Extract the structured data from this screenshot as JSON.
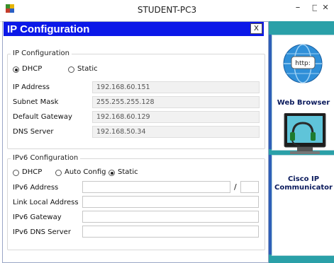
{
  "window": {
    "title": "STUDENT-PC3",
    "minimize_glyph": "–",
    "maximize_glyph": "□",
    "close_glyph": "✕"
  },
  "dialog": {
    "title": "IP Configuration",
    "close_label": "X"
  },
  "ipv4": {
    "legend": "IP Configuration",
    "mode_dhcp_label": "DHCP",
    "mode_static_label": "Static",
    "selected_mode": "DHCP",
    "ip_address_label": "IP Address",
    "ip_address_value": "192.168.60.151",
    "subnet_mask_label": "Subnet Mask",
    "subnet_mask_value": "255.255.255.128",
    "default_gateway_label": "Default Gateway",
    "default_gateway_value": "192.168.60.129",
    "dns_server_label": "DNS Server",
    "dns_server_value": "192.168.50.34"
  },
  "ipv6": {
    "legend": "IPv6 Configuration",
    "mode_dhcp_label": "DHCP",
    "mode_auto_label": "Auto Config",
    "mode_static_label": "Static",
    "selected_mode": "Static",
    "address_label": "IPv6 Address",
    "address_value": "",
    "prefix_separator": "/",
    "prefix_value": "",
    "link_local_label": "Link Local Address",
    "link_local_value": "",
    "gateway_label": "IPv6 Gateway",
    "gateway_value": "",
    "dns_server_label": "IPv6 DNS Server",
    "dns_server_value": ""
  },
  "desktop_apps": [
    {
      "label": "Web Browser",
      "icon": "web-browser-icon",
      "icon_text": "http:"
    },
    {
      "label": "Cisco IP Communicator",
      "label_line1": "Cisco IP",
      "label_line2": "Communicator",
      "icon": "cisco-ip-communicator-icon"
    }
  ],
  "colors": {
    "dialog_header": "#0b18e8",
    "apps_background": "#2aa0a8"
  }
}
